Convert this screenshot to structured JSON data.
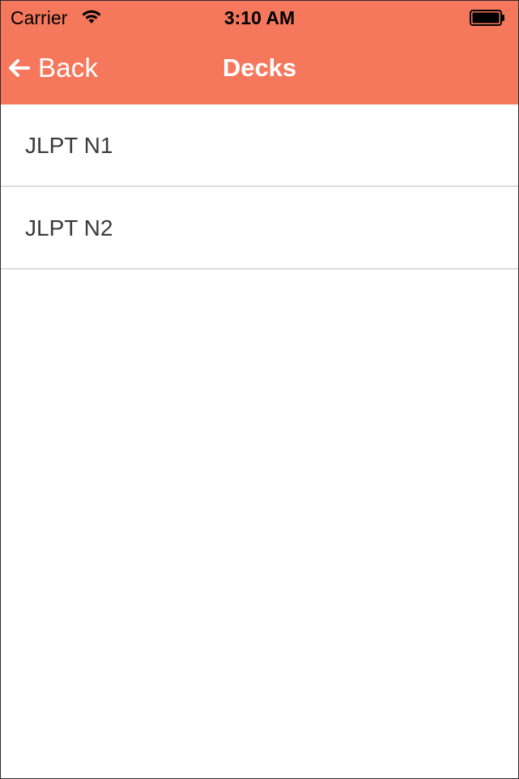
{
  "status_bar": {
    "carrier": "Carrier",
    "time": "3:10 AM",
    "wifi_icon": "wifi-icon",
    "battery_icon": "battery-icon"
  },
  "nav_bar": {
    "back_label": "Back",
    "back_icon": "arrow-left-icon",
    "title": "Decks",
    "background_color": "#f5785c"
  },
  "decks": [
    {
      "label": "JLPT N1"
    },
    {
      "label": "JLPT N2"
    }
  ]
}
